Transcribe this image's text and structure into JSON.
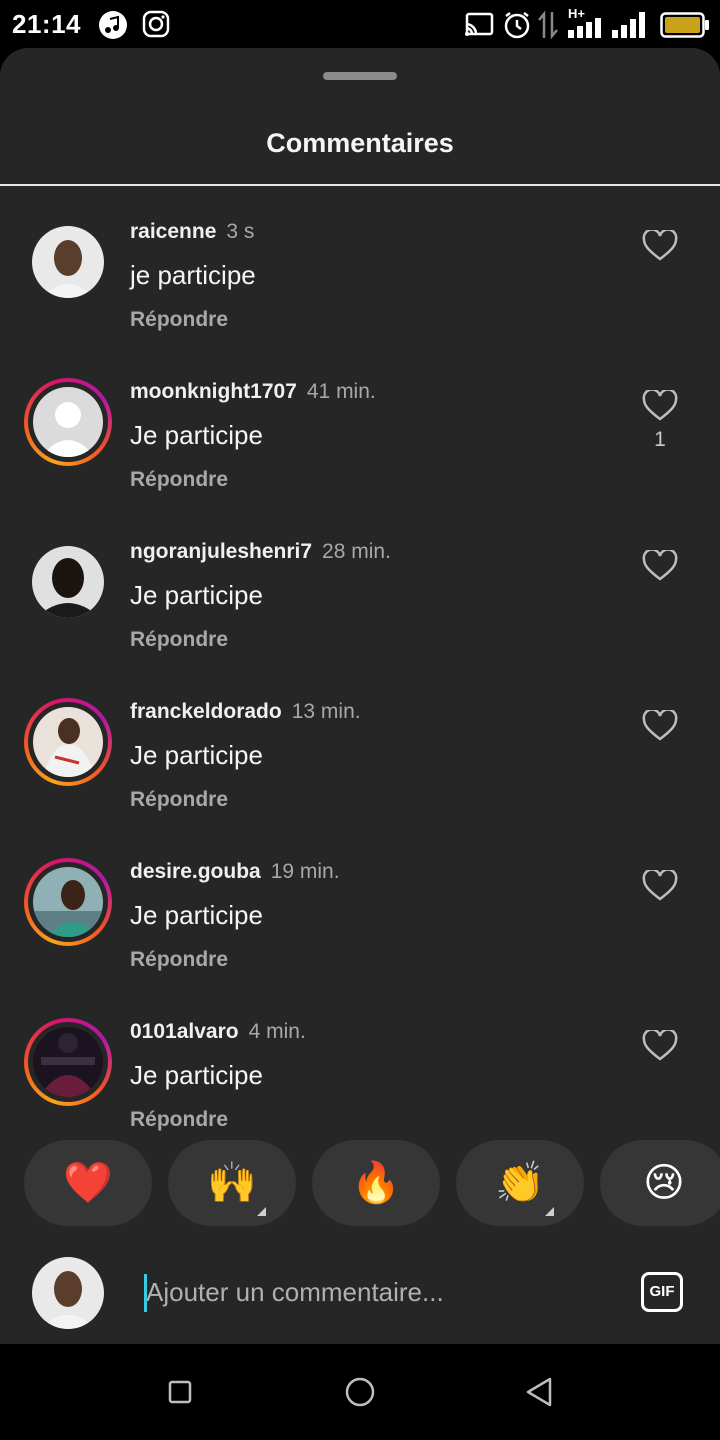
{
  "status_bar": {
    "time": "21:14",
    "left_icons": [
      "music-note-icon",
      "instagram-icon"
    ],
    "right_icons": [
      "cast-icon",
      "alarm-icon",
      "data-arrows-icon",
      "signal-icon",
      "signal-icon",
      "battery-icon"
    ],
    "network_label": "H+"
  },
  "sheet": {
    "title": "Commentaires"
  },
  "comments": [
    {
      "username": "raicenne",
      "ago": "3 s",
      "text": "je participe",
      "reply_label": "Répondre",
      "likes": "",
      "story_ring": false,
      "avatar": "avatar-photo"
    },
    {
      "username": "moonknight1707",
      "ago": "41 min.",
      "text": "Je participe",
      "reply_label": "Répondre",
      "likes": "1",
      "story_ring": true,
      "avatar": "default-avatar"
    },
    {
      "username": "ngoranjuleshenri7",
      "ago": "28 min.",
      "text": "Je participe",
      "reply_label": "Répondre",
      "likes": "",
      "story_ring": false,
      "avatar": "avatar-photo"
    },
    {
      "username": "franckeldorado",
      "ago": "13 min.",
      "text": "Je participe",
      "reply_label": "Répondre",
      "likes": "",
      "story_ring": true,
      "avatar": "avatar-photo"
    },
    {
      "username": "desire.gouba",
      "ago": "19 min.",
      "text": "Je participe",
      "reply_label": "Répondre",
      "likes": "",
      "story_ring": true,
      "avatar": "avatar-photo"
    },
    {
      "username": "0101alvaro",
      "ago": "4 min.",
      "text": "Je participe",
      "reply_label": "Répondre",
      "likes": "",
      "story_ring": true,
      "avatar": "avatar-photo"
    }
  ],
  "reactions": [
    {
      "emoji": "❤️",
      "name": "red-heart"
    },
    {
      "emoji": "🙌",
      "name": "raising-hands"
    },
    {
      "emoji": "🔥",
      "name": "fire"
    },
    {
      "emoji": "👏",
      "name": "clapping-hands"
    },
    {
      "emoji": "😢",
      "name": "crying-face"
    }
  ],
  "composer": {
    "placeholder": "Ajouter un commentaire...",
    "gif_label": "GIF"
  },
  "colors": {
    "sheet_bg": "#262626",
    "text_secondary": "#a8a8a8",
    "story_ring_start": "#f9a51a",
    "story_ring_end": "#d8146c",
    "cursor": "#3cc7e6"
  }
}
